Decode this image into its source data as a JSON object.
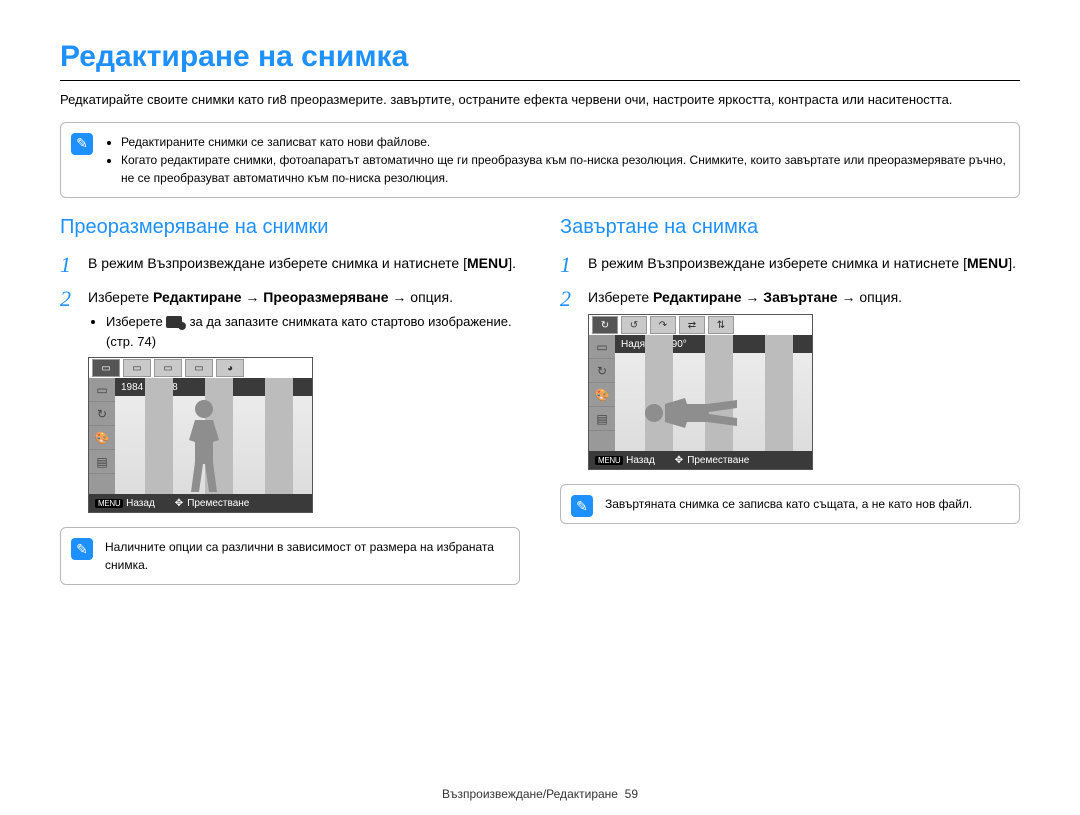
{
  "title": "Редактиране на снимка",
  "intro": "Редкатирайте своите снимки като ги8 преоразмерите. завъртите, остраните ефекта червени очи, настроите яркостта, контраста или наситеността.",
  "top_note": {
    "bullets": [
      "Редактираните снимки се записват като нови файлове.",
      "Когато редактирате снимки, фотоапаратът автоматично ще ги преобразува към по-ниска резолюция. Снимките, които завъртате или преоразмерявате ръчно, не се преобразуват автоматично към по-ниска резолюция."
    ]
  },
  "left": {
    "heading": "Преоразмеряване на снимки",
    "step1_a": "В режим Възпроизвеждане изберете снимка и натиснете [",
    "step1_menu": "MENU",
    "step1_b": "].",
    "step2_a": "Изберете ",
    "step2_b": "Редактиране",
    "step2_arrow1": " → ",
    "step2_c": "Преоразмеряване",
    "step2_arrow2": " → опция.",
    "bullet_a": "Изберете ",
    "bullet_b": ", за да запазите снимката като стартово изображение. (стр. 74)",
    "cam_caption": "1984 X 1488",
    "cam_back_key": "MENU",
    "cam_back": "Назад",
    "cam_move": "Преместване",
    "note": "Наличните опции са различни в зависимост от размера на избраната снимка."
  },
  "right": {
    "heading": "Завъртане на снимка",
    "step1_a": "В режим Възпроизвеждане изберете снимка и натиснете [",
    "step1_menu": "MENU",
    "step1_b": "].",
    "step2_a": "Изберете ",
    "step2_b": "Редактиране",
    "step2_arrow1": " → ",
    "step2_c": "Завъртане",
    "step2_arrow2": " → опция.",
    "cam_caption": "Надясно с 90°",
    "cam_back_key": "MENU",
    "cam_back": "Назад",
    "cam_move": "Преместване",
    "note": "Завъртяната снимка се записва като същата, а не като нов файл."
  },
  "footer_label": "Възпроизвеждане/Редактиране",
  "footer_page": "59"
}
